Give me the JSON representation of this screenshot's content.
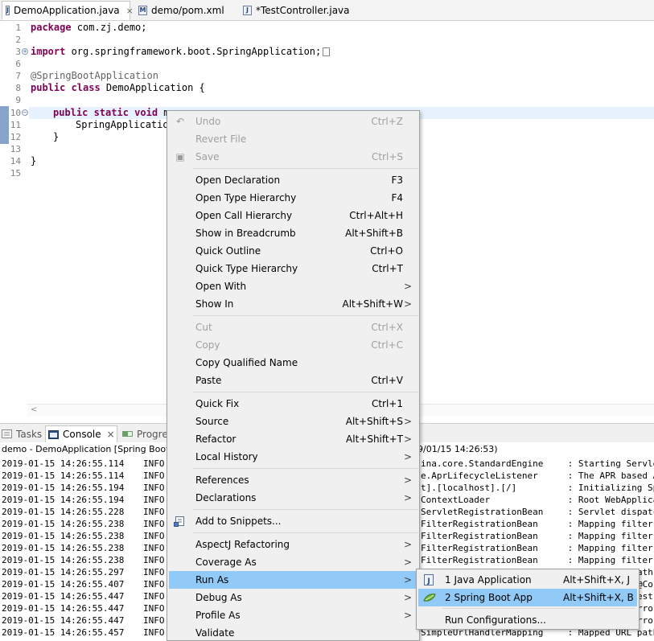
{
  "tabs": [
    {
      "label": "DemoApplication.java",
      "icon": "java-file-icon",
      "active": true,
      "close": "×"
    },
    {
      "label": "demo/pom.xml",
      "icon": "maven-file-icon",
      "active": false
    },
    {
      "label": "*TestController.java",
      "icon": "java-file-icon",
      "active": false
    }
  ],
  "editor": {
    "lines": [
      {
        "n": "1",
        "text": "package com.zj.demo;"
      },
      {
        "n": "2",
        "text": ""
      },
      {
        "n": "3",
        "text": "import org.springframework.boot.SpringApplication;"
      },
      {
        "n": "6",
        "text": ""
      },
      {
        "n": "7",
        "text": "@SpringBootApplication"
      },
      {
        "n": "8",
        "text": "public class DemoApplication {"
      },
      {
        "n": "9",
        "text": ""
      },
      {
        "n": "10",
        "text": "    public static void m"
      },
      {
        "n": "11",
        "text": "        SpringApplicatio"
      },
      {
        "n": "12",
        "text": "    }"
      },
      {
        "n": "13",
        "text": ""
      },
      {
        "n": "14",
        "text": "}"
      },
      {
        "n": "15",
        "text": ""
      }
    ],
    "l1_kw": "package",
    "l1_rest": " com.zj.demo;",
    "l3_kw": "import",
    "l3_rest": " org.springframework.boot.SpringApplication;",
    "l7_ann": "@SpringBootApplication",
    "l8_kw": "public class",
    "l8_rest": " DemoApplication {",
    "l9_kw": "public static void",
    "l9_rest": " m",
    "l10_text": "SpringApplicatio",
    "l11_text": "}",
    "l13_text": "}",
    "hscroll_arrow": "<"
  },
  "panel": {
    "tabs": [
      {
        "label": "Tasks",
        "active": false
      },
      {
        "label": "Console",
        "active": true,
        "close": "×"
      },
      {
        "label": "Progre",
        "active": false
      }
    ],
    "console_title": "demo - DemoApplication [Spring Boot A",
    "console_title_time": "9/01/15 14:26:53)",
    "log": [
      {
        "ts": "2019-01-15 14:26:55.114",
        "lvl": "INFO",
        "src": "ina.core.StandardEngine",
        "msg": " : Starting Servle"
      },
      {
        "ts": "2019-01-15 14:26:55.114",
        "lvl": "INFO",
        "src": "e.AprLifecycleListener",
        "msg": " : The APR based A"
      },
      {
        "ts": "2019-01-15 14:26:55.194",
        "lvl": "INFO",
        "src": "t].[localhost].[/]",
        "msg": " : Initializing Sp"
      },
      {
        "ts": "2019-01-15 14:26:55.194",
        "lvl": "INFO",
        "src": "ContextLoader",
        "msg": " : Root WebApplica"
      },
      {
        "ts": "2019-01-15 14:26:55.228",
        "lvl": "INFO",
        "src": "ServletRegistrationBean",
        "msg": " : Servlet dispatc"
      },
      {
        "ts": "2019-01-15 14:26:55.238",
        "lvl": "INFO",
        "src": "FilterRegistrationBean",
        "msg": " : Mapping filter:"
      },
      {
        "ts": "2019-01-15 14:26:55.238",
        "lvl": "INFO",
        "src": "FilterRegistrationBean",
        "msg": " : Mapping filter:"
      },
      {
        "ts": "2019-01-15 14:26:55.238",
        "lvl": "INFO",
        "src": "FilterRegistrationBean",
        "msg": " : Mapping filter:"
      },
      {
        "ts": "2019-01-15 14:26:55.238",
        "lvl": "INFO",
        "src": "FilterRegistrationBean",
        "msg": " : Mapping filter:"
      },
      {
        "ts": "2019-01-15 14:26:55.297",
        "lvl": "INFO",
        "src": "",
        "msg": "ath"
      },
      {
        "ts": "2019-01-15 14:26:55.407",
        "lvl": "INFO",
        "src": "",
        "msg": "@Co"
      },
      {
        "ts": "2019-01-15 14:26:55.447",
        "lvl": "INFO",
        "src": "",
        "msg": "est"
      },
      {
        "ts": "2019-01-15 14:26:55.447",
        "lvl": "INFO",
        "src": "",
        "msg": "rro"
      },
      {
        "ts": "2019-01-15 14:26:55.447",
        "lvl": "INFO",
        "src": "",
        "msg": "rro"
      },
      {
        "ts": "2019-01-15 14:26:55.457",
        "lvl": "INFO",
        "src": "SimpleUrlHandlerMapping",
        "msg": " : Mapped URL path"
      }
    ]
  },
  "context_menu": {
    "items": [
      {
        "label": "Undo",
        "shortcut": "Ctrl+Z",
        "disabled": true,
        "icon": "undo-icon"
      },
      {
        "label": "Revert File",
        "shortcut": "",
        "disabled": true
      },
      {
        "label": "Save",
        "shortcut": "Ctrl+S",
        "disabled": true,
        "icon": "save-icon"
      },
      {
        "label": "Open Declaration",
        "shortcut": "F3"
      },
      {
        "label": "Open Type Hierarchy",
        "shortcut": "F4"
      },
      {
        "label": "Open Call Hierarchy",
        "shortcut": "Ctrl+Alt+H"
      },
      {
        "label": "Show in Breadcrumb",
        "shortcut": "Alt+Shift+B"
      },
      {
        "label": "Quick Outline",
        "shortcut": "Ctrl+O"
      },
      {
        "label": "Quick Type Hierarchy",
        "shortcut": "Ctrl+T"
      },
      {
        "label": "Open With",
        "submenu": true
      },
      {
        "label": "Show In",
        "shortcut": "Alt+Shift+W",
        "submenu": true
      },
      {
        "label": "Cut",
        "shortcut": "Ctrl+X",
        "disabled": true
      },
      {
        "label": "Copy",
        "shortcut": "Ctrl+C",
        "disabled": true
      },
      {
        "label": "Copy Qualified Name",
        "shortcut": ""
      },
      {
        "label": "Paste",
        "shortcut": "Ctrl+V"
      },
      {
        "label": "Quick Fix",
        "shortcut": "Ctrl+1"
      },
      {
        "label": "Source",
        "shortcut": "Alt+Shift+S",
        "submenu": true
      },
      {
        "label": "Refactor",
        "shortcut": "Alt+Shift+T",
        "submenu": true
      },
      {
        "label": "Local History",
        "submenu": true
      },
      {
        "label": "References",
        "submenu": true
      },
      {
        "label": "Declarations",
        "submenu": true
      },
      {
        "label": "Add to Snippets...",
        "icon": "snippets-icon"
      },
      {
        "label": "AspectJ Refactoring",
        "submenu": true
      },
      {
        "label": "Coverage As",
        "submenu": true
      },
      {
        "label": "Run As",
        "submenu": true,
        "selected": true
      },
      {
        "label": "Debug As",
        "submenu": true
      },
      {
        "label": "Profile As",
        "submenu": true
      },
      {
        "label": "Validate"
      }
    ],
    "submenu_arrow": ">"
  },
  "run_as_submenu": {
    "items": [
      {
        "label": "1 Java Application",
        "shortcut": "Alt+Shift+X, J",
        "icon": "java-application-icon"
      },
      {
        "label": "2 Spring Boot App",
        "shortcut": "Alt+Shift+X, B",
        "icon": "spring-boot-icon",
        "selected": true
      },
      {
        "label": "Run Configurations...",
        "shortcut": ""
      }
    ]
  },
  "colors": {
    "keyword": "#7f0055",
    "annotation": "#646464",
    "selection": "#91c9f7",
    "menu_bg": "#f0f0f0",
    "disabled": "#a0a0a0"
  }
}
